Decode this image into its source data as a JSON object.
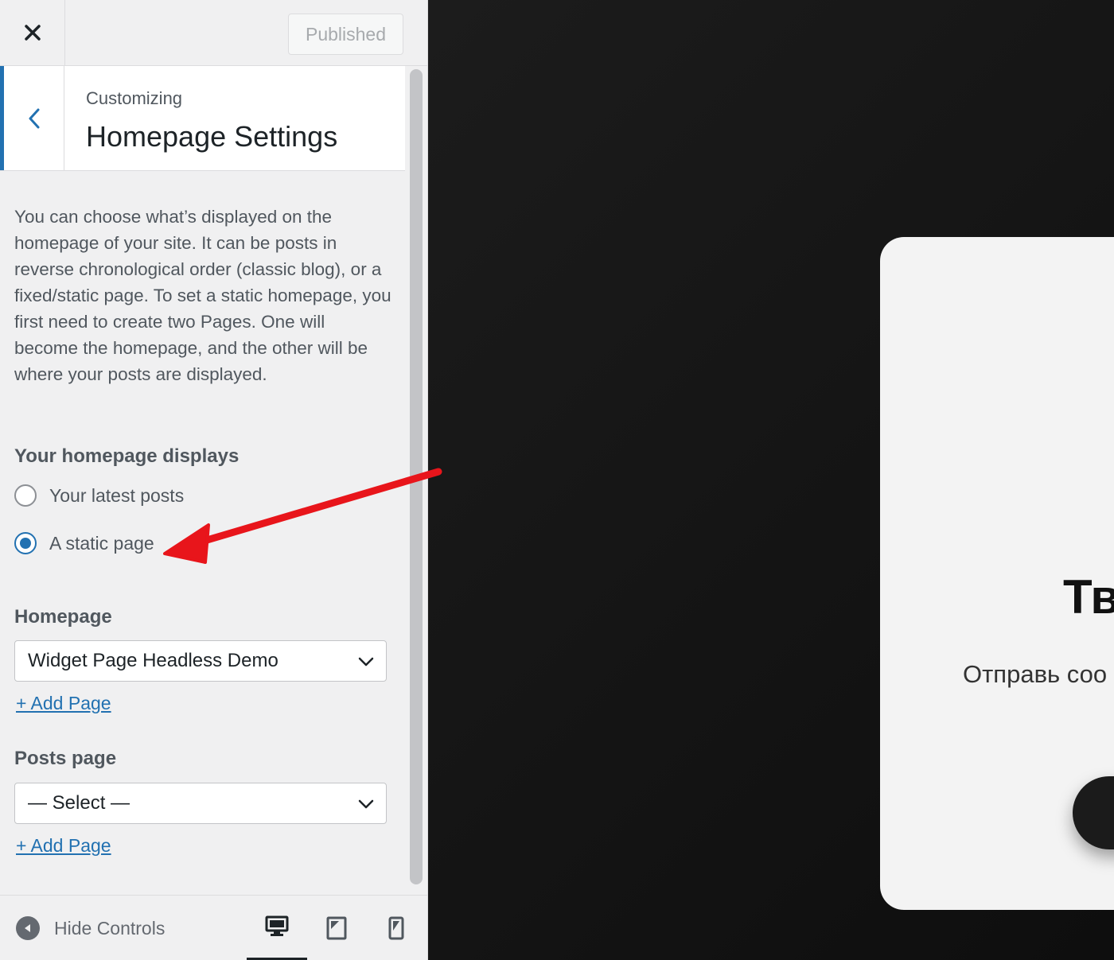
{
  "topbar": {
    "published_label": "Published"
  },
  "section": {
    "customizing_label": "Customizing",
    "title": "Homepage Settings"
  },
  "description": "You can choose what’s displayed on the homepage of your site. It can be posts in reverse chronological order (classic blog), or a fixed/static page. To set a static homepage, you first need to create two Pages. One will become the homepage, and the other will be where your posts are displayed.",
  "homepage_displays": {
    "label": "Your homepage displays",
    "options": [
      {
        "label": "Your latest posts",
        "selected": false
      },
      {
        "label": "A static page",
        "selected": true
      }
    ]
  },
  "homepage": {
    "label": "Homepage",
    "selected": "Widget Page Headless Demo",
    "add_link": "+ Add Page"
  },
  "posts_page": {
    "label": "Posts page",
    "selected": "— Select —",
    "add_link": "+ Add Page"
  },
  "footer": {
    "hide_controls_label": "Hide Controls",
    "active_device": "desktop"
  },
  "preview": {
    "heading": "Тв",
    "subtext": "Отправь соо"
  },
  "colors": {
    "accent": "#2271b1",
    "annotation_arrow": "#e8151b"
  }
}
